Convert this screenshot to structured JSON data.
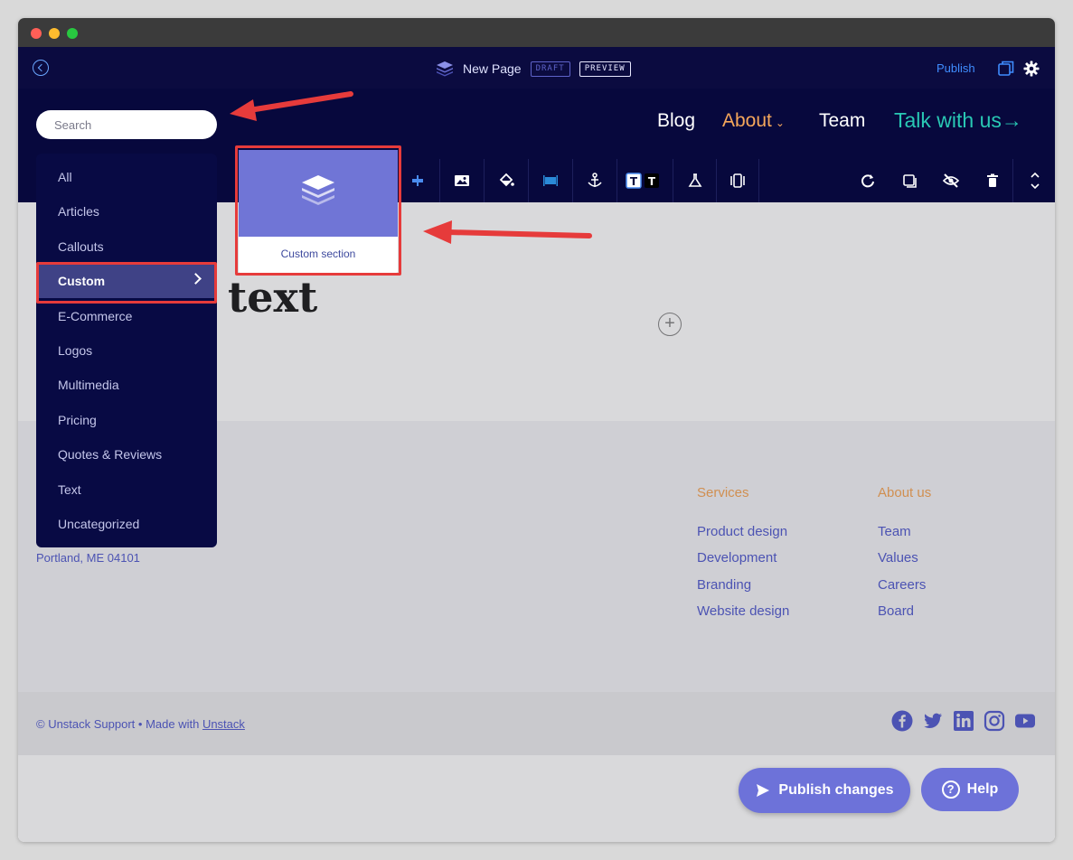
{
  "editor": {
    "page_title": "New Page",
    "draft_badge": "DRAFT",
    "preview_badge": "PREVIEW",
    "publish_label": "Publish"
  },
  "site_nav": {
    "items": [
      {
        "label": "Blog"
      },
      {
        "label": "About"
      },
      {
        "label": "Team"
      },
      {
        "label": "Talk with us"
      }
    ],
    "about_chevron": "⌄",
    "talk_arrow": "→"
  },
  "toolbar": {
    "icons": [
      "layout-icon",
      "align-icon",
      "image-icon",
      "paint-bucket-icon",
      "width-icon",
      "anchor-icon",
      "text-light-icon",
      "text-dark-icon",
      "flask-icon",
      "carousel-icon",
      "sync-icon",
      "duplicate-icon",
      "hide-icon",
      "trash-icon",
      "reorder-icon"
    ]
  },
  "search": {
    "placeholder": "Search"
  },
  "categories": [
    {
      "label": "All"
    },
    {
      "label": "Articles"
    },
    {
      "label": "Callouts"
    },
    {
      "label": "Custom",
      "selected": true
    },
    {
      "label": "E-Commerce"
    },
    {
      "label": "Logos"
    },
    {
      "label": "Multimedia"
    },
    {
      "label": "Pricing"
    },
    {
      "label": "Quotes & Reviews"
    },
    {
      "label": "Text"
    },
    {
      "label": "Uncategorized"
    }
  ],
  "section_card": {
    "label": "Custom section"
  },
  "hero": {
    "text": "text"
  },
  "footer": {
    "address": "Portland, ME 04101",
    "columns": [
      {
        "title": "Services",
        "links": [
          "Product design",
          "Development",
          "Branding",
          "Website design"
        ]
      },
      {
        "title": "About us",
        "links": [
          "Team",
          "Values",
          "Careers",
          "Board"
        ]
      }
    ],
    "copyright_prefix": "© Unstack Support • Made with ",
    "copyright_link": "Unstack",
    "social": [
      "facebook-icon",
      "twitter-icon",
      "linkedin-icon",
      "instagram-icon",
      "youtube-icon"
    ]
  },
  "actions": {
    "publish_changes": "Publish changes",
    "help": "Help",
    "help_glyph": "?"
  },
  "colors": {
    "navy": "#07083d",
    "accent": "#6d72d9",
    "orange": "#f5a75b",
    "teal": "#29c8b4",
    "highlight": "#e63b3b"
  }
}
